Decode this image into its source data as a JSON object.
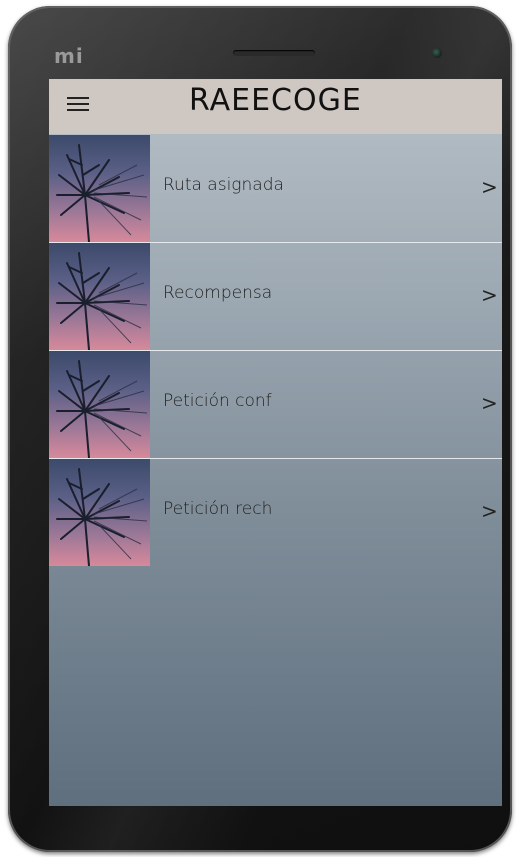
{
  "device": {
    "brand_logo": "mi",
    "bezel_color": "#111111"
  },
  "app": {
    "title": "RAEECOGE",
    "menu_icon": "hamburger-menu-icon",
    "header_color": "#cfc7c2"
  },
  "menu_items": [
    {
      "label": "Ruta asignada",
      "icon": "chevron-right-icon",
      "thumbnail": "palm-tree-sunset-image"
    },
    {
      "label": "Recompensa",
      "icon": "chevron-right-icon",
      "thumbnail": "palm-tree-sunset-image"
    },
    {
      "label": "Petición conf",
      "icon": "chevron-right-icon",
      "thumbnail": "palm-tree-sunset-image"
    },
    {
      "label": "Petición rech",
      "icon": "chevron-right-icon",
      "thumbnail": "palm-tree-sunset-image"
    }
  ],
  "chevron_glyph": ">"
}
